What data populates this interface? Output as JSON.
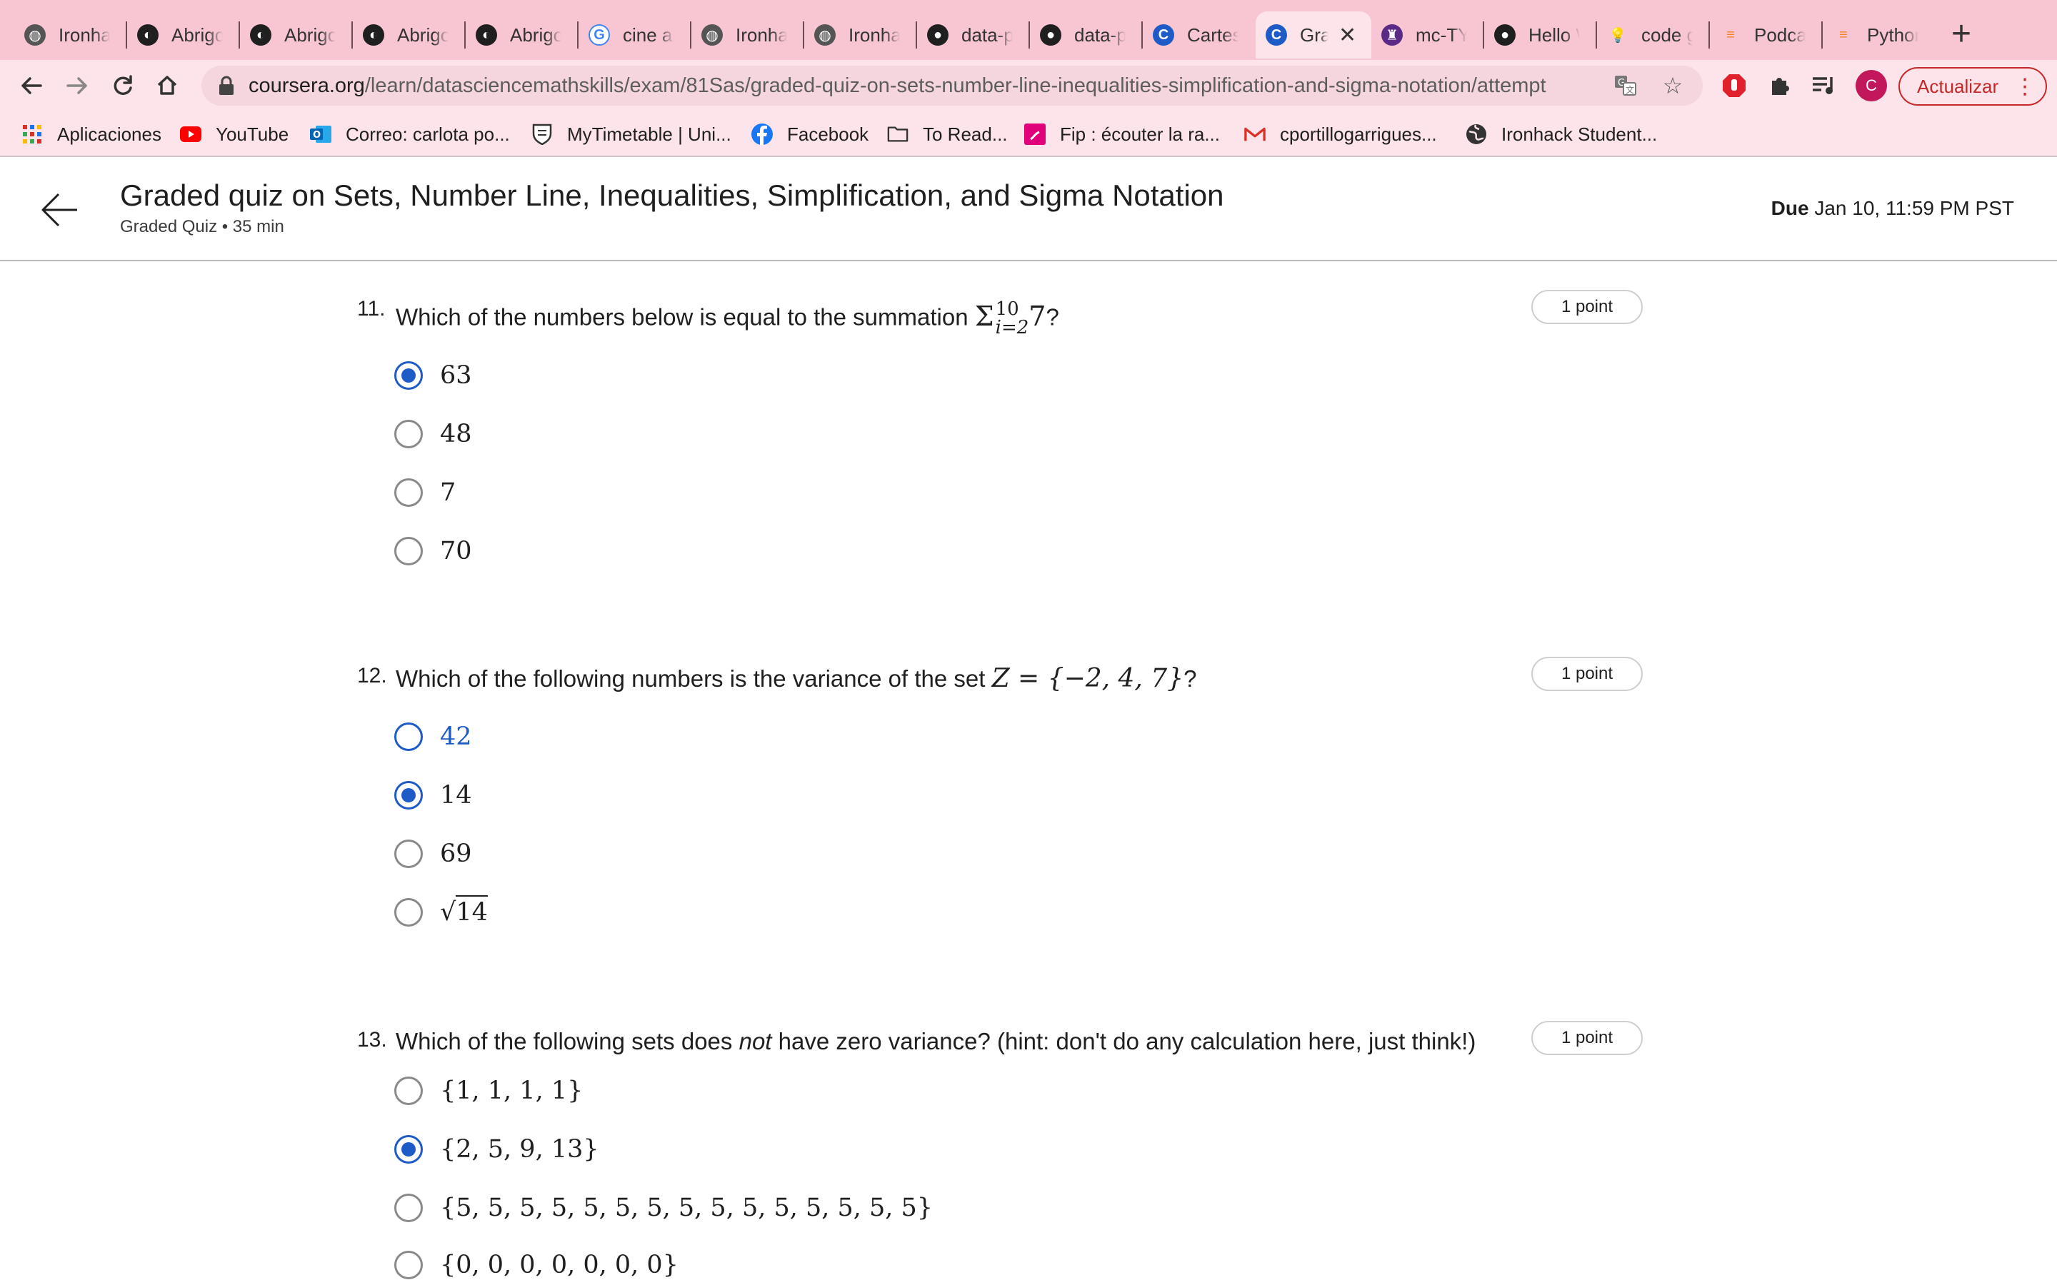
{
  "browser": {
    "tabs": [
      {
        "label": "Ironhack",
        "icon": "globe-icon",
        "color": "#555555"
      },
      {
        "label": "Abrigos",
        "icon": "shop-icon",
        "color": "#1f1f1f"
      },
      {
        "label": "Abrigos",
        "icon": "shop-icon",
        "color": "#1f1f1f"
      },
      {
        "label": "Abrigos",
        "icon": "shop-icon",
        "color": "#1f1f1f"
      },
      {
        "label": "Abrigos",
        "icon": "shop-icon",
        "color": "#1f1f1f"
      },
      {
        "label": "cine ab",
        "icon": "google-icon",
        "color": "#4285f4"
      },
      {
        "label": "Ironhack",
        "icon": "globe-icon",
        "color": "#555555"
      },
      {
        "label": "Ironhack",
        "icon": "globe-icon",
        "color": "#555555"
      },
      {
        "label": "data-p",
        "icon": "github-icon",
        "color": "#1f1f1f"
      },
      {
        "label": "data-p",
        "icon": "github-icon",
        "color": "#1f1f1f"
      },
      {
        "label": "Cartes",
        "icon": "coursera-icon",
        "color": "#1e5bc6"
      },
      {
        "label": "Gra",
        "icon": "coursera-icon",
        "color": "#1e5bc6",
        "active": true
      },
      {
        "label": "mc-TY",
        "icon": "crest-icon",
        "color": "#5b2a86"
      },
      {
        "label": "Hello W",
        "icon": "github-icon",
        "color": "#1f1f1f"
      },
      {
        "label": "code g",
        "icon": "bulb-icon",
        "color": "#f2b400"
      },
      {
        "label": "Podcas",
        "icon": "stack-icon",
        "color": "#f48024"
      },
      {
        "label": "Python",
        "icon": "stack-icon",
        "color": "#f48024"
      }
    ],
    "close_tab_glyph": "✕",
    "new_tab_glyph": "+",
    "url_host": "coursera.org",
    "url_path": "/learn/datasciencemathskills/exam/81Sas/graded-quiz-on-sets-number-line-inequalities-simplification-and-sigma-notation/attempt",
    "profile_initial": "C",
    "update_label": "Actualizar",
    "bookmarks": [
      {
        "label": "Aplicaciones",
        "icon": "apps-grid-icon"
      },
      {
        "label": "YouTube",
        "icon": "youtube-icon"
      },
      {
        "label": "Correo: carlota po...",
        "icon": "outlook-icon"
      },
      {
        "label": "MyTimetable | Uni...",
        "icon": "shield-crest-icon"
      },
      {
        "label": "Facebook",
        "icon": "facebook-icon"
      },
      {
        "label": "To Read...",
        "icon": "folder-icon"
      },
      {
        "label": "Fip : écouter la ra...",
        "icon": "fip-icon"
      },
      {
        "label": "cportillogarrigues...",
        "icon": "gmail-icon"
      },
      {
        "label": "Ironhack Student...",
        "icon": "globe-icon"
      }
    ]
  },
  "header": {
    "title": "Graded quiz on Sets, Number Line, Inequalities, Simplification, and Sigma Notation",
    "subtitle": "Graded Quiz • 35 min",
    "due_label": "Due",
    "due_value": "Jan 10, 11:59 PM PST"
  },
  "questions": [
    {
      "number": "11.",
      "text": "Which of the numbers below is equal to the summation",
      "math": {
        "sigma": "Σ",
        "upper": "10",
        "lower": "i=2",
        "term": "7",
        "tail": "?"
      },
      "points": "1 point",
      "options": [
        {
          "label": "63",
          "checked": true
        },
        {
          "label": "48",
          "checked": false
        },
        {
          "label": "7",
          "checked": false
        },
        {
          "label": "70",
          "checked": false
        }
      ]
    },
    {
      "number": "12.",
      "text": "Which of the following numbers is the variance of the set",
      "math_text": "Z = {−2, 4, 7}",
      "tail": "?",
      "points": "1 point",
      "options": [
        {
          "label": "42",
          "checked": false,
          "hover": true
        },
        {
          "label": "14",
          "checked": true
        },
        {
          "label": "69",
          "checked": false
        },
        {
          "label": "14",
          "checked": false,
          "sqrt": true
        }
      ]
    },
    {
      "number": "13.",
      "text_before": "Which of the following sets does",
      "text_em": "not",
      "text_after": "have zero variance? (hint: don't do any calculation here, just think!)",
      "points": "1 point",
      "options": [
        {
          "label": "{1, 1, 1, 1}",
          "checked": false
        },
        {
          "label": "{2, 5, 9, 13}",
          "checked": true
        },
        {
          "label": "{5, 5, 5, 5, 5, 5, 5, 5, 5, 5, 5, 5, 5, 5, 5}",
          "checked": false
        },
        {
          "label": "{0, 0, 0, 0, 0, 0, 0}",
          "checked": false
        }
      ]
    }
  ]
}
